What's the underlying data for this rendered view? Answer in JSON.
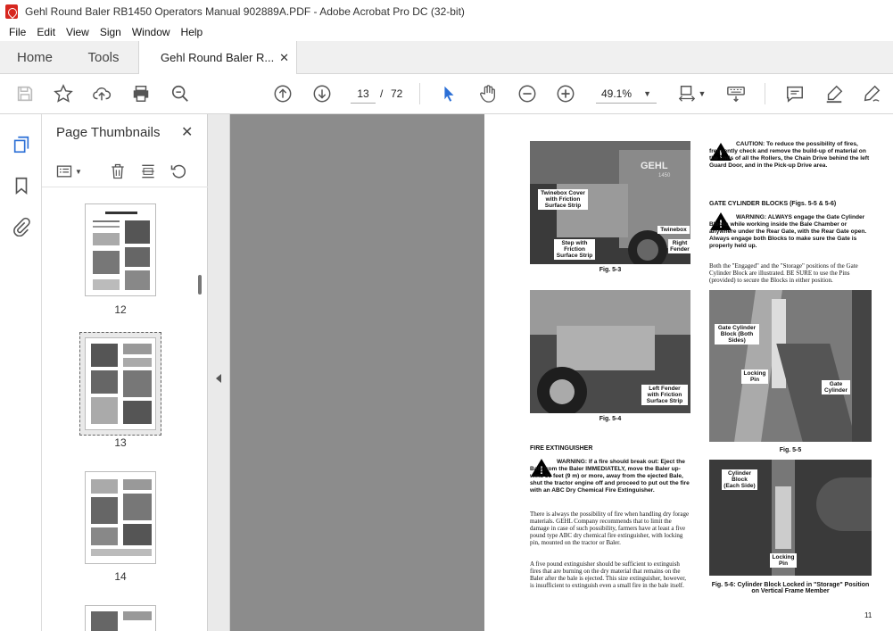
{
  "window": {
    "title": "Gehl Round Baler RB1450 Operators Manual 902889A.PDF - Adobe Acrobat Pro DC (32-bit)"
  },
  "menu": [
    "File",
    "Edit",
    "View",
    "Sign",
    "Window",
    "Help"
  ],
  "tabs": {
    "home": "Home",
    "tools": "Tools",
    "document": "Gehl Round Baler R...",
    "close": "✕"
  },
  "toolbar": {
    "current_page": "13",
    "separator": "/",
    "total_pages": "72",
    "zoom": "49.1%"
  },
  "thumbnails": {
    "title": "Page Thumbnails",
    "close": "✕",
    "pages": [
      {
        "label": "12"
      },
      {
        "label": "13",
        "selected": true
      },
      {
        "label": "14"
      }
    ]
  },
  "document": {
    "caution": "CAUTION: To reduce the possibility of fires, frequently check and remove the build-up of material on the ends of all the Rollers, the Chain Drive behind the left Guard Door, and in the Pick-up Drive area.",
    "gate_heading": "GATE CYLINDER BLOCKS (Figs. 5-5 & 5-6)",
    "gate_warning": "WARNING: ALWAYS engage the Gate Cylinder Blocks while working inside the Bale Chamber or anywhere under the Rear Gate, with the Rear Gate open. Always engage both Blocks to make sure the Gate is properly held up.",
    "gate_text": "Both the \"Engaged\" and the \"Storage\" positions of the Gate Cylinder Block are illustrated. BE SURE to use the Pins (provided) to secure the Blocks in either position.",
    "fig53": {
      "caption": "Fig. 5-3",
      "brand": "GEHL",
      "model": "1450",
      "label_twinebox_cover": "Twinebox Cover with Friction Surface Strip",
      "label_step": "Step with Friction Surface Strip",
      "label_twinebox": "Twinebox",
      "label_right_fender": "Right Fender"
    },
    "fig54": {
      "caption": "Fig. 5-4",
      "label_left_fender": "Left Fender with Friction Surface Strip"
    },
    "fig55": {
      "caption": "Fig. 5-5",
      "label_gate_block": "Gate Cylinder Block (Both Sides)",
      "label_locking_pin": "Locking Pin",
      "label_gate_cylinder": "Gate Cylinder"
    },
    "fig56": {
      "caption": "Fig. 5-6: Cylinder Block Locked in \"Storage\" Position on Vertical Frame Member",
      "label_cylinder_block": "Cylinder Block (Each Side)",
      "label_locking_pin": "Locking Pin"
    },
    "fire_heading": "FIRE EXTINGUISHER",
    "fire_warning": "WARNING: If a fire should break out: Eject the Bale from the Baler IMMEDIATELY, move the Baler up-wind 30 feet (9 m) or more, away from the ejected Bale, shut the tractor engine off and proceed to put out the fire with an ABC Dry Chemical Fire Extinguisher.",
    "fire_text1": "There is always the possibility of fire when handling dry forage materials. GEHL Company recommends that to limit the damage in case of such possibility, farmers have at least a five pound type ABC dry chemical fire extinguisher, with locking pin, mounted on the tractor or Baler.",
    "fire_text2": "A five pound extinguisher should be sufficient to extinguish fires that are burning on the dry material that remains on the Baler after the bale is ejected. This size extinguisher, however, is insufficient to extinguish even a small fire in the bale itself.",
    "page_number": "11"
  }
}
